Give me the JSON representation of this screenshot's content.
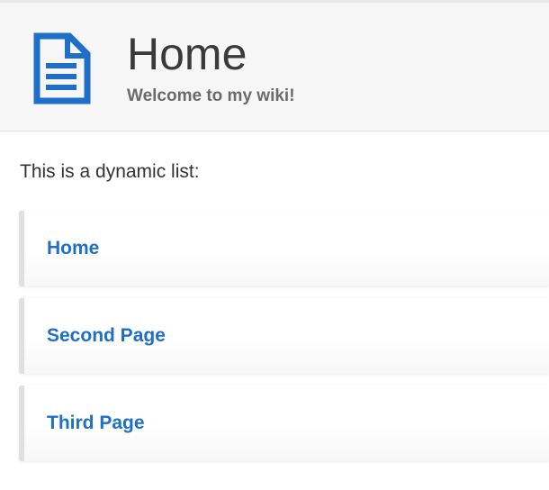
{
  "header": {
    "icon": "document-icon",
    "title": "Home",
    "subtitle": "Welcome to my wiki!"
  },
  "content": {
    "intro": "This is a dynamic list:",
    "items": [
      {
        "label": "Home"
      },
      {
        "label": "Second Page"
      },
      {
        "label": "Third Page"
      }
    ]
  },
  "colors": {
    "accent": "#1f6ec8",
    "icon": "#1f6ec8",
    "header_bg": "#f6f6f6"
  }
}
